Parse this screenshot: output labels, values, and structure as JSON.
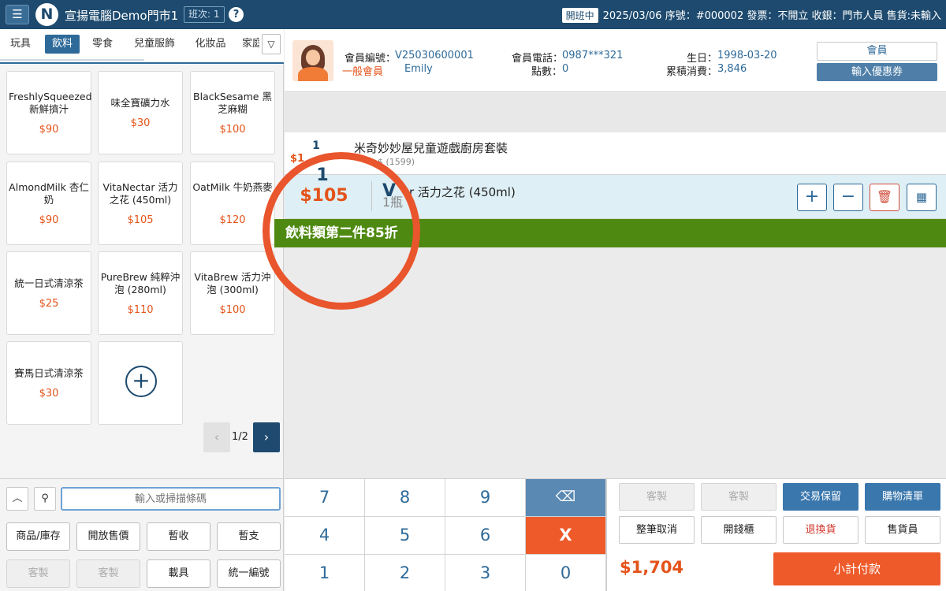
{
  "topbar": {
    "menu_icon": "hamburger-icon",
    "logo_letter": "N",
    "title": "宣揚電腦Demo門市1",
    "shift": "班次: 1",
    "help": "?",
    "open_status": "開班中",
    "status_line": "2025/03/06 序號：#000002 發票：不開立 收銀：門市人員 售貨:未輸入"
  },
  "categories": [
    "玩具",
    "飲料",
    "零食",
    "兒童服飾",
    "化妝品",
    "家庭"
  ],
  "active_category": "飲料",
  "products": [
    {
      "name": "FreshlySqueezed 新鮮擠汁",
      "price": "$90"
    },
    {
      "name": "味全寶礦力水",
      "price": "$30"
    },
    {
      "name": "BlackSesame 黑芝麻糊",
      "price": "$100"
    },
    {
      "name": "AlmondMilk 杏仁奶",
      "price": "$90"
    },
    {
      "name": "VitaNectar 活力之花 (450ml)",
      "price": "$105"
    },
    {
      "name": "OatMilk 牛奶燕麥",
      "price": "$120"
    },
    {
      "name": "統一日式清涼茶",
      "price": "$25"
    },
    {
      "name": "PureBrew 純粹沖泡 (280ml)",
      "price": "$110"
    },
    {
      "name": "VitaBrew 活力沖泡 (300ml)",
      "price": "$100"
    },
    {
      "name": "賽馬日式清涼茶",
      "price": "$30"
    }
  ],
  "pagination": {
    "label": "1/2"
  },
  "search": {
    "placeholder": "輸入或掃描條碼"
  },
  "left_buttons": [
    "商品/庫存",
    "開放售價",
    "暫收",
    "暫支",
    "客製",
    "客製",
    "載具",
    "統一編號"
  ],
  "member": {
    "id_label": "會員編號：",
    "id": "V25030600001",
    "tier": "一般會員",
    "name": "Emily",
    "phone_label": "會員電話：",
    "phone": "0987***321",
    "points_label": "點數：",
    "points": "0",
    "birthday_label": "生日：",
    "birthday": "1998-03-20",
    "spent_label": "累積消費：",
    "spent": "3,846",
    "member_button": "會員",
    "coupon_button": "輸入優惠券"
  },
  "cart": [
    {
      "qty": "1",
      "price": "$1",
      "name": "米奇妙妙屋兒童遊戲廚房套裝",
      "sub": "$ (1599)"
    },
    {
      "qty": "1",
      "price": "$105",
      "name": "r 活力之花 (450ml)",
      "name_initial": "V",
      "sub": "1瓶"
    }
  ],
  "promo": "飲料類第二件85折",
  "numpad": {
    "keys": [
      "7",
      "8",
      "9",
      "4",
      "5",
      "6",
      "1",
      "2",
      "3",
      "0"
    ],
    "backspace_icon": "backspace-icon",
    "clear": "X"
  },
  "right_buttons": [
    "客製",
    "客製",
    "交易保留",
    "購物清單",
    "整筆取消",
    "開錢櫃",
    "退換貨",
    "售貨員"
  ],
  "total": "$1,704",
  "pay_button": "小計付款",
  "colors": {
    "brand": "#1d4a6e",
    "accent": "#ee5a2a",
    "promo": "#4e8a11"
  }
}
